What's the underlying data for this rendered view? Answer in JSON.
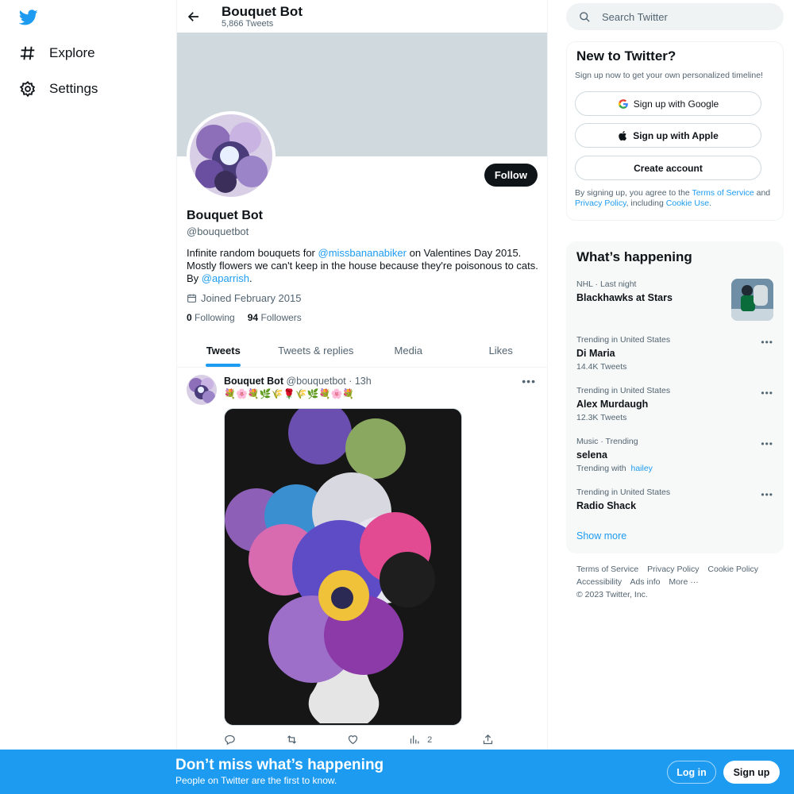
{
  "nav": {
    "logo": "twitter-bird-icon",
    "items": [
      {
        "label": "Explore",
        "icon": "hashtag-icon"
      },
      {
        "label": "Settings",
        "icon": "gear-icon"
      }
    ]
  },
  "header": {
    "title": "Bouquet Bot",
    "subtitle": "5,866 Tweets"
  },
  "profile": {
    "name": "Bouquet Bot",
    "handle": "@bouquetbot",
    "follow_label": "Follow",
    "bio_1": "Infinite random bouquets for ",
    "bio_link_1": "@missbananabiker",
    "bio_2": " on Valentines Day 2015. Mostly flowers we can't keep in the house because they're poisonous to cats. By ",
    "bio_link_2": "@aparrish",
    "bio_3": ".",
    "joined": "Joined February 2015",
    "following_count": "0",
    "following_label": "Following",
    "followers_count": "94",
    "followers_label": "Followers"
  },
  "tabs": [
    "Tweets",
    "Tweets & replies",
    "Media",
    "Likes"
  ],
  "tweet": {
    "name": "Bouquet Bot",
    "handle": "@bouquetbot",
    "time": "· 13h",
    "emojis": "💐🌸💐🌿🌾🌹🌾🌿💐🌸💐",
    "views": "2"
  },
  "search": {
    "placeholder": "Search Twitter"
  },
  "new_card": {
    "title": "New to Twitter?",
    "subtitle": "Sign up now to get your own personalized timeline!",
    "google": "Sign up with Google",
    "apple": "Sign up with Apple",
    "create": "Create account",
    "legal_1": "By signing up, you agree to the ",
    "tos": "Terms of Service",
    "legal_2": " and ",
    "privacy": "Privacy Policy",
    "legal_3": ", including ",
    "cookie": "Cookie Use",
    "legal_4": "."
  },
  "happening": {
    "title": "What’s happening",
    "trends": [
      {
        "meta": "NHL · Last night",
        "title": "Blackhawks at Stars",
        "sub": ""
      },
      {
        "meta": "Trending in United States",
        "title": "Di Maria",
        "sub": "14.4K Tweets"
      },
      {
        "meta": "Trending in United States",
        "title": "Alex Murdaugh",
        "sub": "12.3K Tweets"
      },
      {
        "meta": "Music · Trending",
        "title": "selena",
        "sub": "Trending with",
        "sub_link": "hailey"
      },
      {
        "meta": "Trending in United States",
        "title": "Radio Shack",
        "sub": ""
      }
    ],
    "show_more": "Show more"
  },
  "footer": {
    "links": [
      "Terms of Service",
      "Privacy Policy",
      "Cookie Policy",
      "Accessibility",
      "Ads info",
      "More ···"
    ],
    "copyright": "© 2023 Twitter, Inc."
  },
  "bottom_bar": {
    "title": "Don’t miss what’s happening",
    "subtitle": "People on Twitter are the first to know.",
    "login": "Log in",
    "signup": "Sign up"
  },
  "colors": {
    "accent": "#1d9bf0",
    "text": "#0f1419",
    "muted": "#536471",
    "banner": "#cfd9de"
  }
}
